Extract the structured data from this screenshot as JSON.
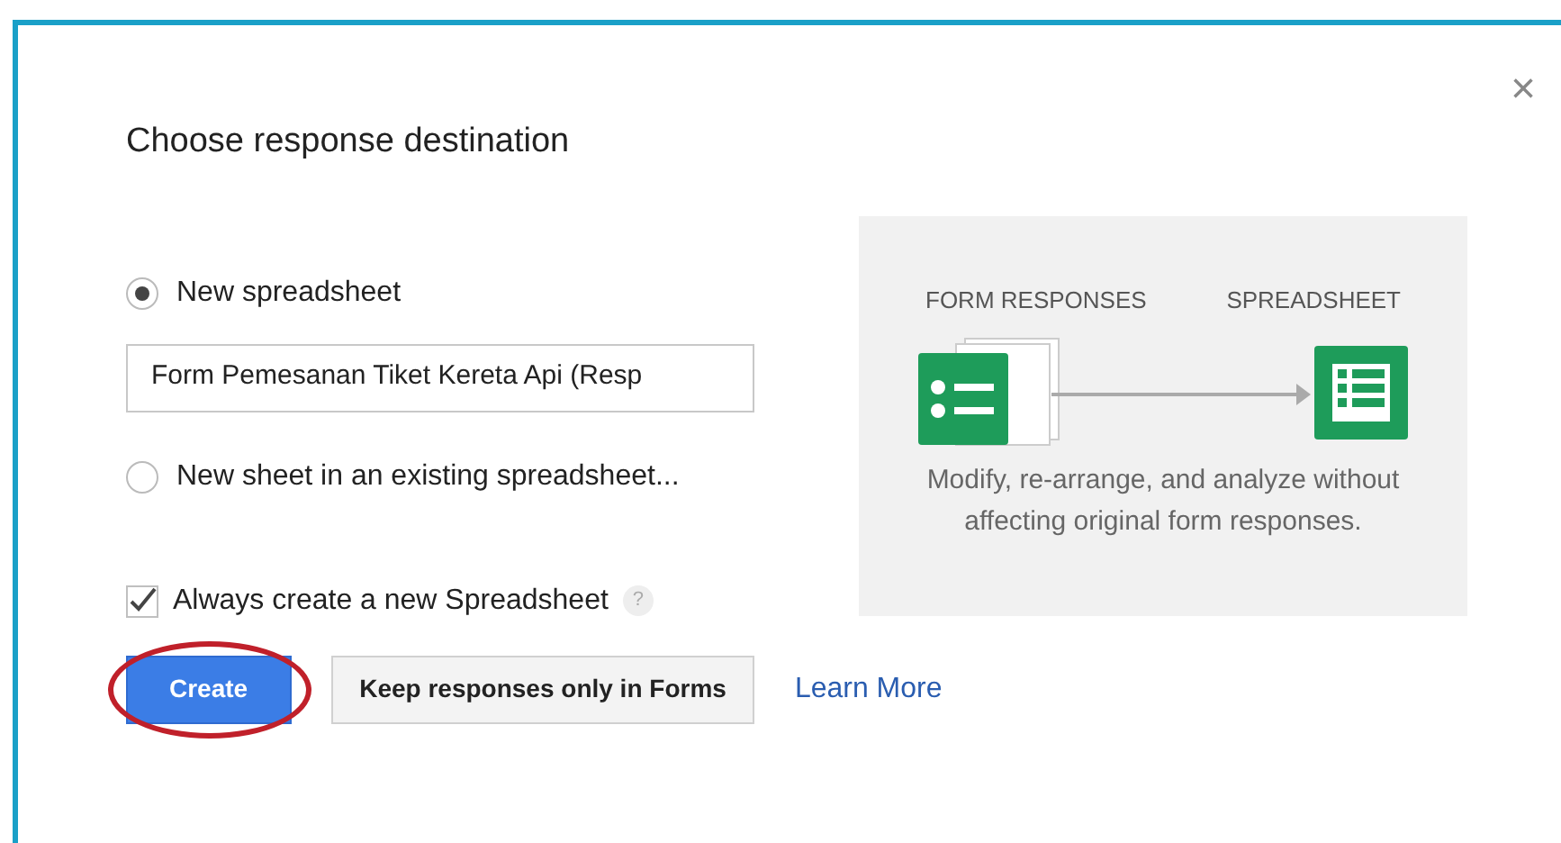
{
  "dialog": {
    "title": "Choose response destination",
    "close": "×"
  },
  "options": [
    {
      "label": "New spreadsheet",
      "selected": true
    },
    {
      "label": "New sheet in an existing spreadsheet...",
      "selected": false
    }
  ],
  "name_field": {
    "value": "Form Pemesanan Tiket Kereta Api (Resp"
  },
  "always_new": {
    "label": "Always create a new Spreadsheet",
    "checked": true,
    "help": "?"
  },
  "illustration": {
    "left_label": "FORM RESPONSES",
    "right_label": "SPREADSHEET",
    "caption": "Modify, re-arrange, and analyze without affecting original form responses."
  },
  "buttons": [
    {
      "label": "Create",
      "kind": "primary",
      "circled": true
    },
    {
      "label": "Keep responses only in Forms",
      "kind": "secondary",
      "circled": false
    },
    {
      "label": "Learn More",
      "kind": "link",
      "circled": false
    }
  ]
}
